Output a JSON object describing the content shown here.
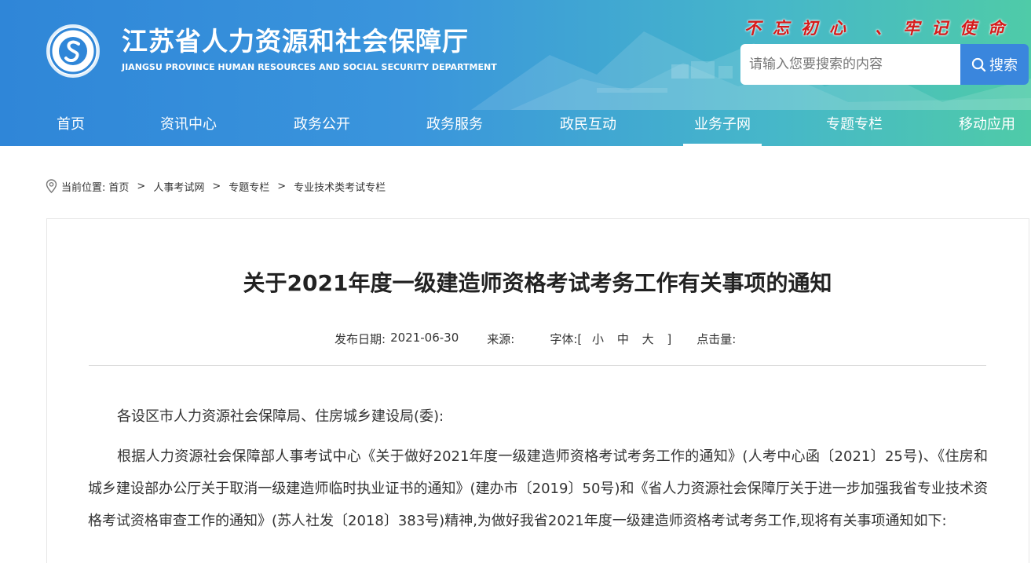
{
  "header": {
    "title": "江苏省人力资源和社会保障厅",
    "subtitle": "JIANGSU PROVINCE HUMAN RESOURCES AND SOCIAL SECURITY DEPARTMENT",
    "slogan": "不忘初心 、牢记使命",
    "search": {
      "placeholder": "请输入您要搜索的内容",
      "button_label": "搜索",
      "icon": "search-icon"
    },
    "colors": {
      "gradient_start": "#2f86d8",
      "gradient_end": "#4fcba8",
      "slogan": "#d61a1a",
      "search_button": "#3a86dd"
    }
  },
  "nav": {
    "items": [
      {
        "label": "首页"
      },
      {
        "label": "资讯中心"
      },
      {
        "label": "政务公开"
      },
      {
        "label": "政务服务"
      },
      {
        "label": "政民互动"
      },
      {
        "label": "业务子网"
      },
      {
        "label": "专题专栏"
      },
      {
        "label": "移动应用"
      }
    ],
    "active": "业务子网"
  },
  "breadcrumb": {
    "prefix": "当前位置:",
    "items": [
      "首页",
      "人事考试网",
      "专题专栏",
      "专业技术类考试专栏"
    ],
    "separator": ">",
    "icon": "location-pin-icon"
  },
  "article": {
    "title": "关于2021年度一级建造师资格考试考务工作有关事项的通知",
    "meta": {
      "date_label": "发布日期:",
      "date": "2021-06-30",
      "source_label": "来源:",
      "font_label": "字体:",
      "font_open": "[",
      "font_small": "小",
      "font_medium": "中",
      "font_large": "大",
      "font_close": "]",
      "hits_label": "点击量:"
    },
    "paragraphs": [
      "各设区市人力资源社会保障局、住房城乡建设局(委):",
      "根据人力资源社会保障部人事考试中心《关于做好2021年度一级建造师资格考试考务工作的通知》(人考中心函〔2021〕25号)、《住房和城乡建设部办公厅关于取消一级建造师临时执业证书的通知》(建办市〔2019〕50号)和《省人力资源社会保障厅关于进一步加强我省专业技术资格考试资格审查工作的通知》(苏人社发〔2018〕383号)精神,为做好我省2021年度一级建造师资格考试考务工作,现将有关事项通知如下:"
    ]
  }
}
